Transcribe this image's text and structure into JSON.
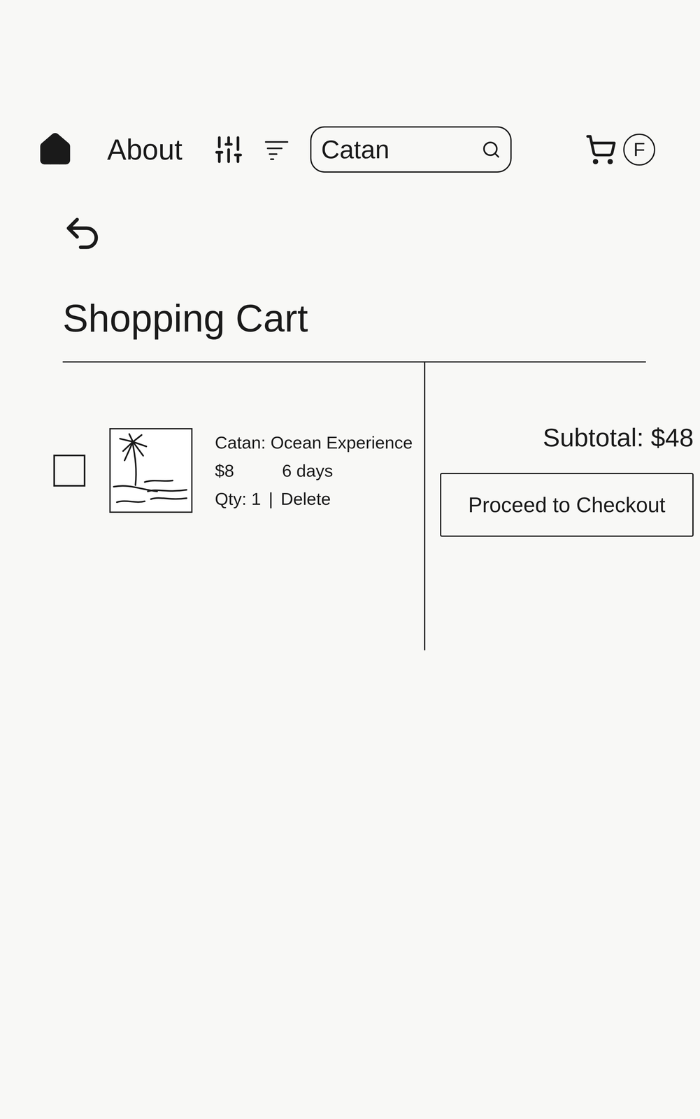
{
  "nav": {
    "items": [
      "About"
    ],
    "search": {
      "value": "Catan"
    },
    "profile": "F"
  },
  "page": {
    "title": "Shopping Cart"
  },
  "cart": {
    "items": [
      {
        "title": "Catan: Ocean Experience",
        "price": "$8",
        "duration": "6 days",
        "qty": "Qty: 1",
        "separator": "|",
        "delete": "Delete",
        "checked": false
      }
    ]
  },
  "summary": {
    "subtotal": "Subtotal: $48",
    "button": "Proceed to Checkout"
  }
}
